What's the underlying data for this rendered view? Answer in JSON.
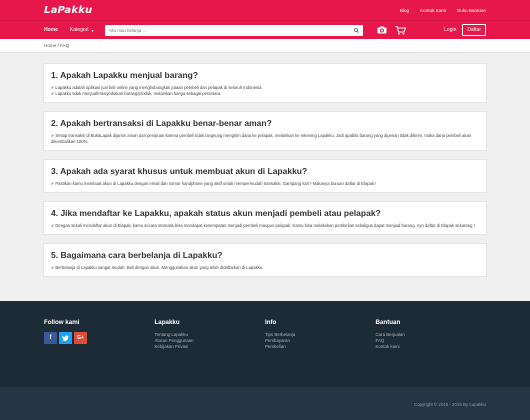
{
  "brand": {
    "logo": "LaPakku",
    "accent": "#e8174b"
  },
  "toplinks": [
    "Blog",
    "Kontak Kami",
    "Buku Bantuan"
  ],
  "nav": {
    "home": "Home",
    "kategori": "Kategori",
    "search_placeholder": "Aku mau belanja ...",
    "login": "Login",
    "daftar": "Daftar"
  },
  "breadcrumb": "Home / FAQ",
  "faq": [
    {
      "q": "1. Apakah Lapakku menjual barang?",
      "a": [
        "Lapakku adalah aplikasi jual beli online yang menghubungkan jutaan pembeli dan pelapak di seluruh Indonesia.",
        "Lapakku tidak menjual/menyediakan barang/produk, melainkan hanya sebagai perantara."
      ]
    },
    {
      "q": "2. Apakah bertransaksi di Lapakku benar-benar aman?",
      "a": [
        "Setiap transaksi di BukaLapak dijamin aman dari penipuan karena pembeli tidak langsung mengirim dana ke pelapak, melainkan ke rekening Lapakku. Jadi apabila barang yang dipesan tidak dikirim, maka dana pembeli akan dikembalikan 100%."
      ]
    },
    {
      "q": "3. Apakah ada syarat khusus untuk membuat akun di Lapakku?",
      "a": [
        "Pastikan kamu membuat akun di Lapakku dengan email dan nomor handphone yang aktif untuk mempermudah transaksi. Gampang kan? Makanya buruan daftar di Elapak !"
      ]
    },
    {
      "q": "4. Jika mendaftar ke Lapakku, apakah status akun menjadi pembeli atau pelapak?",
      "a": [
        "Dengan sekali mendaftar akun di Elapak, kamu secara otomatis bisa mendapat kesempatan menjadi pembeli maupun pelapak. Kamu bisa melakukan pembelian sekaligus dapat menjual barang. Ayo daftar di Elapak sekarang !"
      ]
    },
    {
      "q": "5. Bagaimana cara berbelanja di Lapakku?",
      "a": [
        "Berbelanja di Lapakku sangat mudah. Beli dengan akun. Menggunakan akun yang telah didaftarkan di Lapakku."
      ]
    }
  ],
  "footer": {
    "follow": "Follow kami",
    "cols": [
      {
        "head": "Lapakku",
        "links": [
          "Tentang Lapakku",
          "Aturan Penggunaan",
          "Kebijakan Privasi"
        ]
      },
      {
        "head": "Info",
        "links": [
          "Tips Berbelanja",
          "Pembayaran",
          "Pembelian"
        ]
      },
      {
        "head": "Bantuan",
        "links": [
          "Cara Berjualan",
          "FAQ",
          "Kontak kami"
        ]
      }
    ],
    "copyright": "Copyright © 2015 - 2019 By Lapakku",
    "social_colors": [
      "#3b5998",
      "#1da1f2",
      "#dd4b39"
    ]
  }
}
